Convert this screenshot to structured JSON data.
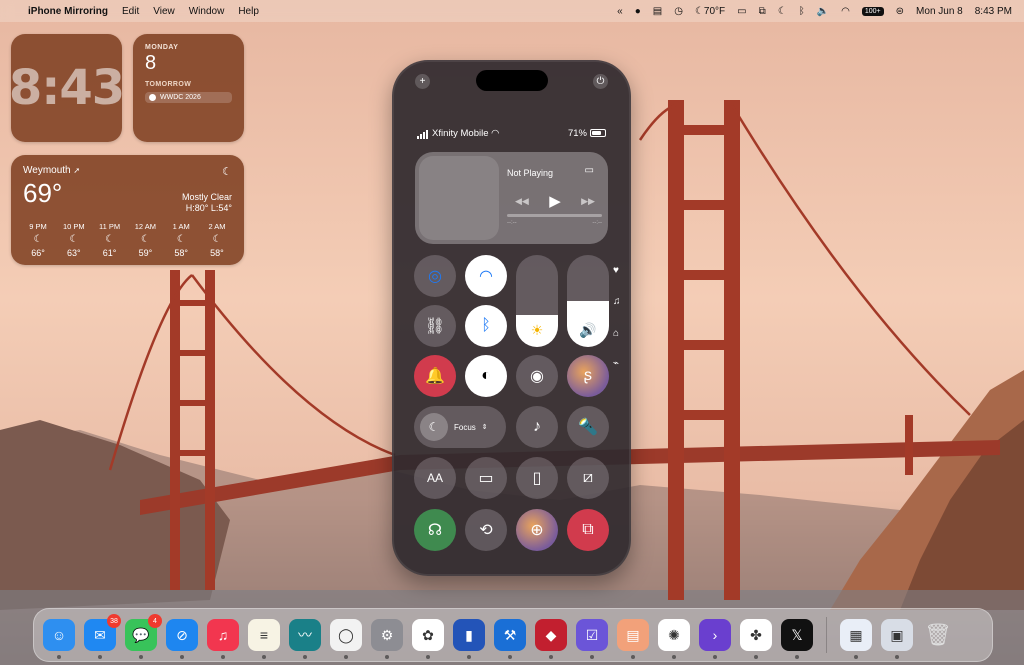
{
  "menubar": {
    "app_name": "iPhone Mirroring",
    "menus": [
      "Edit",
      "View",
      "Window",
      "Help"
    ],
    "weather": "70°F",
    "battery_badge": "100+",
    "date": "Mon Jun 8",
    "time": "8:43 PM"
  },
  "widgets": {
    "clock": {
      "time": "8:43"
    },
    "calendar": {
      "day": "MONDAY",
      "date": "8",
      "tomorrow": "TOMORROW",
      "event": "WWDC 2026"
    },
    "weather": {
      "location": "Weymouth",
      "temp": "69°",
      "condition": "Mostly Clear",
      "hilo": "H:80° L:54°",
      "hours": [
        {
          "time": "9 PM",
          "temp": "66°"
        },
        {
          "time": "10 PM",
          "temp": "63°"
        },
        {
          "time": "11 PM",
          "temp": "61°"
        },
        {
          "time": "12 AM",
          "temp": "59°"
        },
        {
          "time": "1 AM",
          "temp": "58°"
        },
        {
          "time": "2 AM",
          "temp": "58°"
        }
      ]
    }
  },
  "phone": {
    "carrier": "Xfinity Mobile",
    "battery": "71%",
    "media": {
      "title": "Not Playing",
      "elapsed": "--:--",
      "remaining": "--:--"
    },
    "brightness_level": 0.35,
    "volume_level": 0.5,
    "focus_label": "Focus"
  },
  "dock": {
    "apps": [
      {
        "name": "finder",
        "color": "#2e8ff0",
        "glyph": "☺"
      },
      {
        "name": "mail",
        "color": "#1f88f2",
        "glyph": "✉",
        "badge": "38"
      },
      {
        "name": "messages",
        "color": "#38c35a",
        "glyph": "💬",
        "badge": "4"
      },
      {
        "name": "safari",
        "color": "#1e86f0",
        "glyph": "⊘"
      },
      {
        "name": "music",
        "color": "#f2364f",
        "glyph": "♫"
      },
      {
        "name": "notes",
        "color": "#f7f3e4",
        "glyph": "≡"
      },
      {
        "name": "freeform",
        "color": "#1a8088",
        "glyph": "〰"
      },
      {
        "name": "lasso",
        "color": "#f2f2f2",
        "glyph": "◯"
      },
      {
        "name": "system-settings",
        "color": "#8d8d93",
        "glyph": "⚙"
      },
      {
        "name": "photos",
        "color": "#ffffff",
        "glyph": "✿"
      },
      {
        "name": "app-blue",
        "color": "#2354b8",
        "glyph": "▮"
      },
      {
        "name": "xcode-beta",
        "color": "#1a6fd6",
        "glyph": "⚒"
      },
      {
        "name": "app-red",
        "color": "#c21f2f",
        "glyph": "◆"
      },
      {
        "name": "app-purple",
        "color": "#6b55d8",
        "glyph": "☑"
      },
      {
        "name": "app-orange",
        "color": "#f2a17a",
        "glyph": "▤"
      },
      {
        "name": "chatgpt",
        "color": "#ffffff",
        "glyph": "✺"
      },
      {
        "name": "app-terminal",
        "color": "#6a3fcf",
        "glyph": "›"
      },
      {
        "name": "slack",
        "color": "#ffffff",
        "glyph": "✤"
      },
      {
        "name": "x",
        "color": "#111111",
        "glyph": "𝕏"
      }
    ],
    "recent": [
      {
        "name": "recent-window-1",
        "color": "#e9eef7",
        "glyph": "▦"
      },
      {
        "name": "recent-window-2",
        "color": "#d8dde6",
        "glyph": "▣"
      }
    ]
  }
}
